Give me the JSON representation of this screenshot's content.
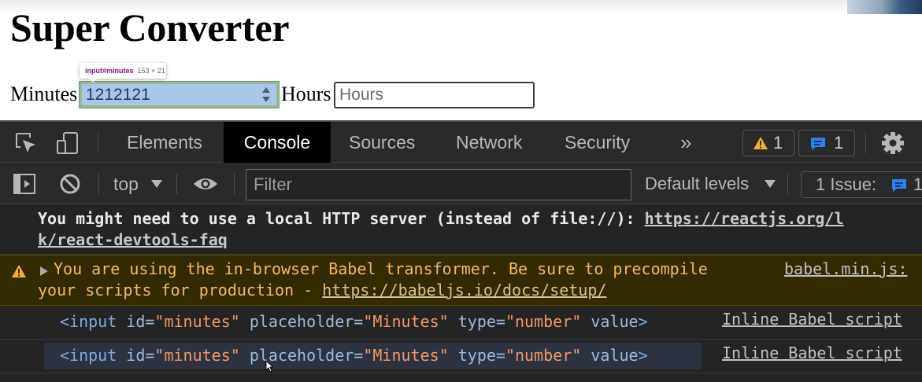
{
  "page": {
    "title": "Super Converter",
    "minutes_label": "Minutes",
    "minutes_value": "1212121",
    "hours_label": "Hours",
    "hours_placeholder": "Hours"
  },
  "inspect_tooltip": {
    "selector": "input#minutes",
    "size": "153 × 21"
  },
  "devtools": {
    "tabs": [
      {
        "label": "Elements",
        "active": false
      },
      {
        "label": "Console",
        "active": true
      },
      {
        "label": "Sources",
        "active": false
      },
      {
        "label": "Network",
        "active": false
      },
      {
        "label": "Security",
        "active": false
      }
    ],
    "more_tabs": "»",
    "warning_count": "1",
    "message_count": "1",
    "toolbar": {
      "context": "top",
      "filter_placeholder": "Filter",
      "levels": "Default levels",
      "issues": "1 Issue:",
      "issues_count": "1"
    },
    "console": {
      "info_prefix": "You might need to use a local HTTP server (instead of file://): ",
      "info_link_line1": "https://reactjs.org/l",
      "info_link_line2": "k/react-devtools-faq",
      "warn_line1": "You are using the in-browser Babel transformer. Be sure to precompile",
      "warn_source": "babel.min.js:",
      "warn_line2_prefix": "your scripts for production - ",
      "warn_link": "https://babeljs.io/docs/setup/",
      "logs": [
        {
          "tag_open": "<input",
          "attr1": " id=",
          "val1": "\"minutes\"",
          "attr2": " placeholder=",
          "val2": "\"Minutes\"",
          "attr3": " type=",
          "val3": "\"number\"",
          "attr4": " value",
          "tag_close": ">",
          "source": "Inline Babel script"
        },
        {
          "tag_open": "<input",
          "attr1": " id=",
          "val1": "\"minutes\"",
          "attr2": " placeholder=",
          "val2": "\"Minutes\"",
          "attr3": " type=",
          "val3": "\"number\"",
          "attr4": " value",
          "tag_close": ">",
          "source": "Inline Babel script"
        }
      ]
    },
    "colors": {
      "warning": "#f2b95e",
      "message_badge": "#2f7fe8",
      "panel_bg": "#242424"
    }
  }
}
